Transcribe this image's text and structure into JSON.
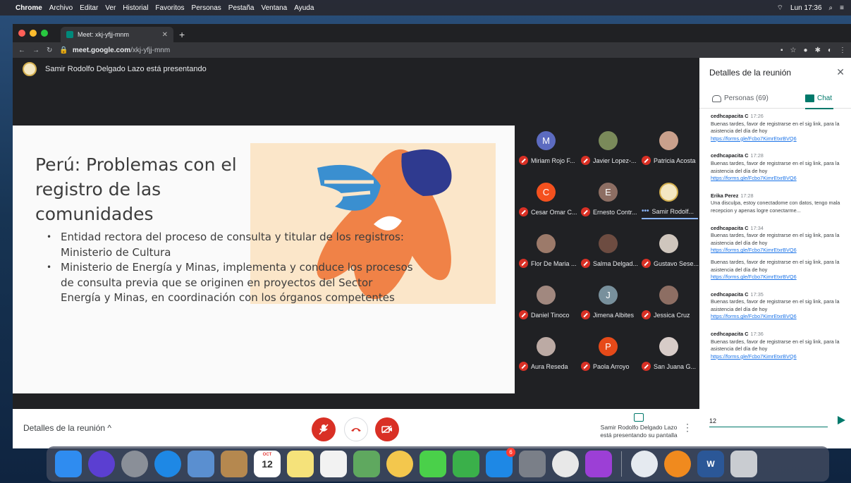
{
  "menubar": {
    "app": "Chrome",
    "items": [
      "Archivo",
      "Editar",
      "Ver",
      "Historial",
      "Favoritos",
      "Personas",
      "Pestaña",
      "Ventana",
      "Ayuda"
    ],
    "clock": "Lun 17:36"
  },
  "browser": {
    "tab_title": "Meet: xkj-yfjj-mnm",
    "url_host": "meet.google.com",
    "url_path": "/xkj-yfjj-mnm"
  },
  "meet": {
    "presenting_text": "Samir Rodolfo Delgado Lazo está presentando",
    "slide": {
      "title": "Perú: Problemas con el registro de las comunidades",
      "bullets": [
        "Entidad rectora del proceso de consulta y titular de los registros: Ministerio de Cultura",
        "Ministerio de Energía y Minas, implementa y conduce los procesos de consulta previa que se originen en proyectos del Sector Energía y Minas, en coordinación con los órganos competentes"
      ]
    },
    "participants": [
      {
        "name": "Miriam Rojo F...",
        "initial": "M",
        "color": "#5c6bc0"
      },
      {
        "name": "Javier Lopez-...",
        "initial": "",
        "color": "#7a8a5a"
      },
      {
        "name": "Patricia Acosta",
        "initial": "",
        "color": "#c9a08c"
      },
      {
        "name": "Cesar Omar C...",
        "initial": "C",
        "color": "#f4511e"
      },
      {
        "name": "Ernesto Contr...",
        "initial": "E",
        "color": "#8d6e63"
      },
      {
        "name": "Samir Rodolf...",
        "initial": "",
        "color": "#f3e7c2"
      },
      {
        "name": "Flor De Maria ...",
        "initial": "",
        "color": "#9c7a6a"
      },
      {
        "name": "Salma Delgad...",
        "initial": "",
        "color": "#6d4c41"
      },
      {
        "name": "Gustavo Sese...",
        "initial": "",
        "color": "#cfc6bd"
      },
      {
        "name": "Daniel Tinoco",
        "initial": "",
        "color": "#a1887f"
      },
      {
        "name": "Jimena Albites",
        "initial": "J",
        "color": "#78909c"
      },
      {
        "name": "Jessica Cruz",
        "initial": "",
        "color": "#8d6e63"
      },
      {
        "name": "Aura Reseda",
        "initial": "",
        "color": "#bcaaa4"
      },
      {
        "name": "Paola Arroyo",
        "initial": "P",
        "color": "#e64a19"
      },
      {
        "name": "San Juana G...",
        "initial": "",
        "color": "#d7ccc8"
      }
    ],
    "controls": {
      "details_label": "Detalles de la reunión",
      "presenter_line1": "Samir Rodolfo Delgado Lazo",
      "presenter_line2": "está presentando su pantalla"
    }
  },
  "panel": {
    "title": "Detalles de la reunión",
    "tab_people": "Personas (69)",
    "tab_chat": "Chat",
    "messages": [
      {
        "author": "cedhcapacita C",
        "time": "17:26",
        "text": "Buenas tardes, favor de registrarse en el sig link, para la asistencia del día de hoy",
        "link": "https://forms.gle/Fcbo7KimrEtxrBVQ6",
        "extra_text": "",
        "extra_link": ""
      },
      {
        "author": "cedhcapacita C",
        "time": "17:28",
        "text": "Buenas tardes, favor de registrarse en el sig link, para la asistencia del día de hoy",
        "link": "https://forms.gle/Fcbo7KimrEtxrBVQ6",
        "extra_text": "",
        "extra_link": ""
      },
      {
        "author": "Erika Perez",
        "time": "17:28",
        "text": "Una disculpa, estoy conectadome con datos, tengo mala recepcion y apenas logre conectarme...",
        "link": "",
        "extra_text": "",
        "extra_link": ""
      },
      {
        "author": "cedhcapacita C",
        "time": "17:34",
        "text": "Buenas tardes, favor de registrarse en el sig link, para la asistencia del día de hoy",
        "link": "https://forms.gle/Fcbo7KimrEtxrBVQ6",
        "extra_text": "Buenas tardes, favor de registrarse en el sig link, para la asistencia del día de hoy",
        "extra_link": "https://forms.gle/Fcbo7KimrEtxrBVQ6"
      },
      {
        "author": "cedhcapacita C",
        "time": "17:35",
        "text": "Buenas tardes, favor de registrarse en el sig link, para la asistencia del día de hoy",
        "link": "https://forms.gle/Fcbo7KimrEtxrBVQ6",
        "extra_text": "",
        "extra_link": ""
      },
      {
        "author": "cedhcapacita C",
        "time": "17:36",
        "text": "Buenas tardes, favor de registrarse en el sig link, para la asistencia del día de hoy",
        "link": "https://forms.gle/Fcbo7KimrEtxrBVQ6",
        "extra_text": "",
        "extra_link": ""
      }
    ],
    "composer_value": "12"
  },
  "dock": {
    "calendar_month": "OCT",
    "calendar_day": "12",
    "appstore_badge": "6",
    "apps": [
      {
        "name": "finder-icon",
        "color": "#2f8cf0",
        "label": ""
      },
      {
        "name": "siri-icon",
        "color": "#5b3fd1",
        "label": ""
      },
      {
        "name": "launchpad-icon",
        "color": "#8a8f98",
        "label": ""
      },
      {
        "name": "safari-icon",
        "color": "#1e88e5",
        "label": ""
      },
      {
        "name": "mail-icon",
        "color": "#5a8fd0",
        "label": ""
      },
      {
        "name": "contacts-icon",
        "color": "#b5884f",
        "label": ""
      },
      {
        "name": "calendar-icon",
        "color": "#ffffff",
        "label": ""
      },
      {
        "name": "notes-icon",
        "color": "#f5e27a",
        "label": ""
      },
      {
        "name": "reminders-icon",
        "color": "#f2f2f2",
        "label": ""
      },
      {
        "name": "maps-icon",
        "color": "#5fa85f",
        "label": ""
      },
      {
        "name": "photos-icon",
        "color": "#f3c74d",
        "label": ""
      },
      {
        "name": "messages-icon",
        "color": "#4ad04a",
        "label": ""
      },
      {
        "name": "facetime-icon",
        "color": "#3ab04a",
        "label": ""
      },
      {
        "name": "appstore-icon",
        "color": "#1e88e5",
        "label": ""
      },
      {
        "name": "system-preferences-icon",
        "color": "#7a7f88",
        "label": ""
      },
      {
        "name": "chrome-icon",
        "color": "#e8e8e8",
        "label": ""
      },
      {
        "name": "podcasts-icon",
        "color": "#9c3fd6",
        "label": ""
      },
      {
        "name": "cleanmymac-icon",
        "color": "#e5eaf0",
        "label": ""
      },
      {
        "name": "books-icon",
        "color": "#f08a1e",
        "label": ""
      },
      {
        "name": "word-icon",
        "color": "#2b5797",
        "label": "W"
      },
      {
        "name": "trash-icon",
        "color": "#c9ccd1",
        "label": ""
      }
    ]
  },
  "colors": {
    "accent": "#00796b",
    "hangup": "#d93025",
    "link": "#1a73e8"
  }
}
